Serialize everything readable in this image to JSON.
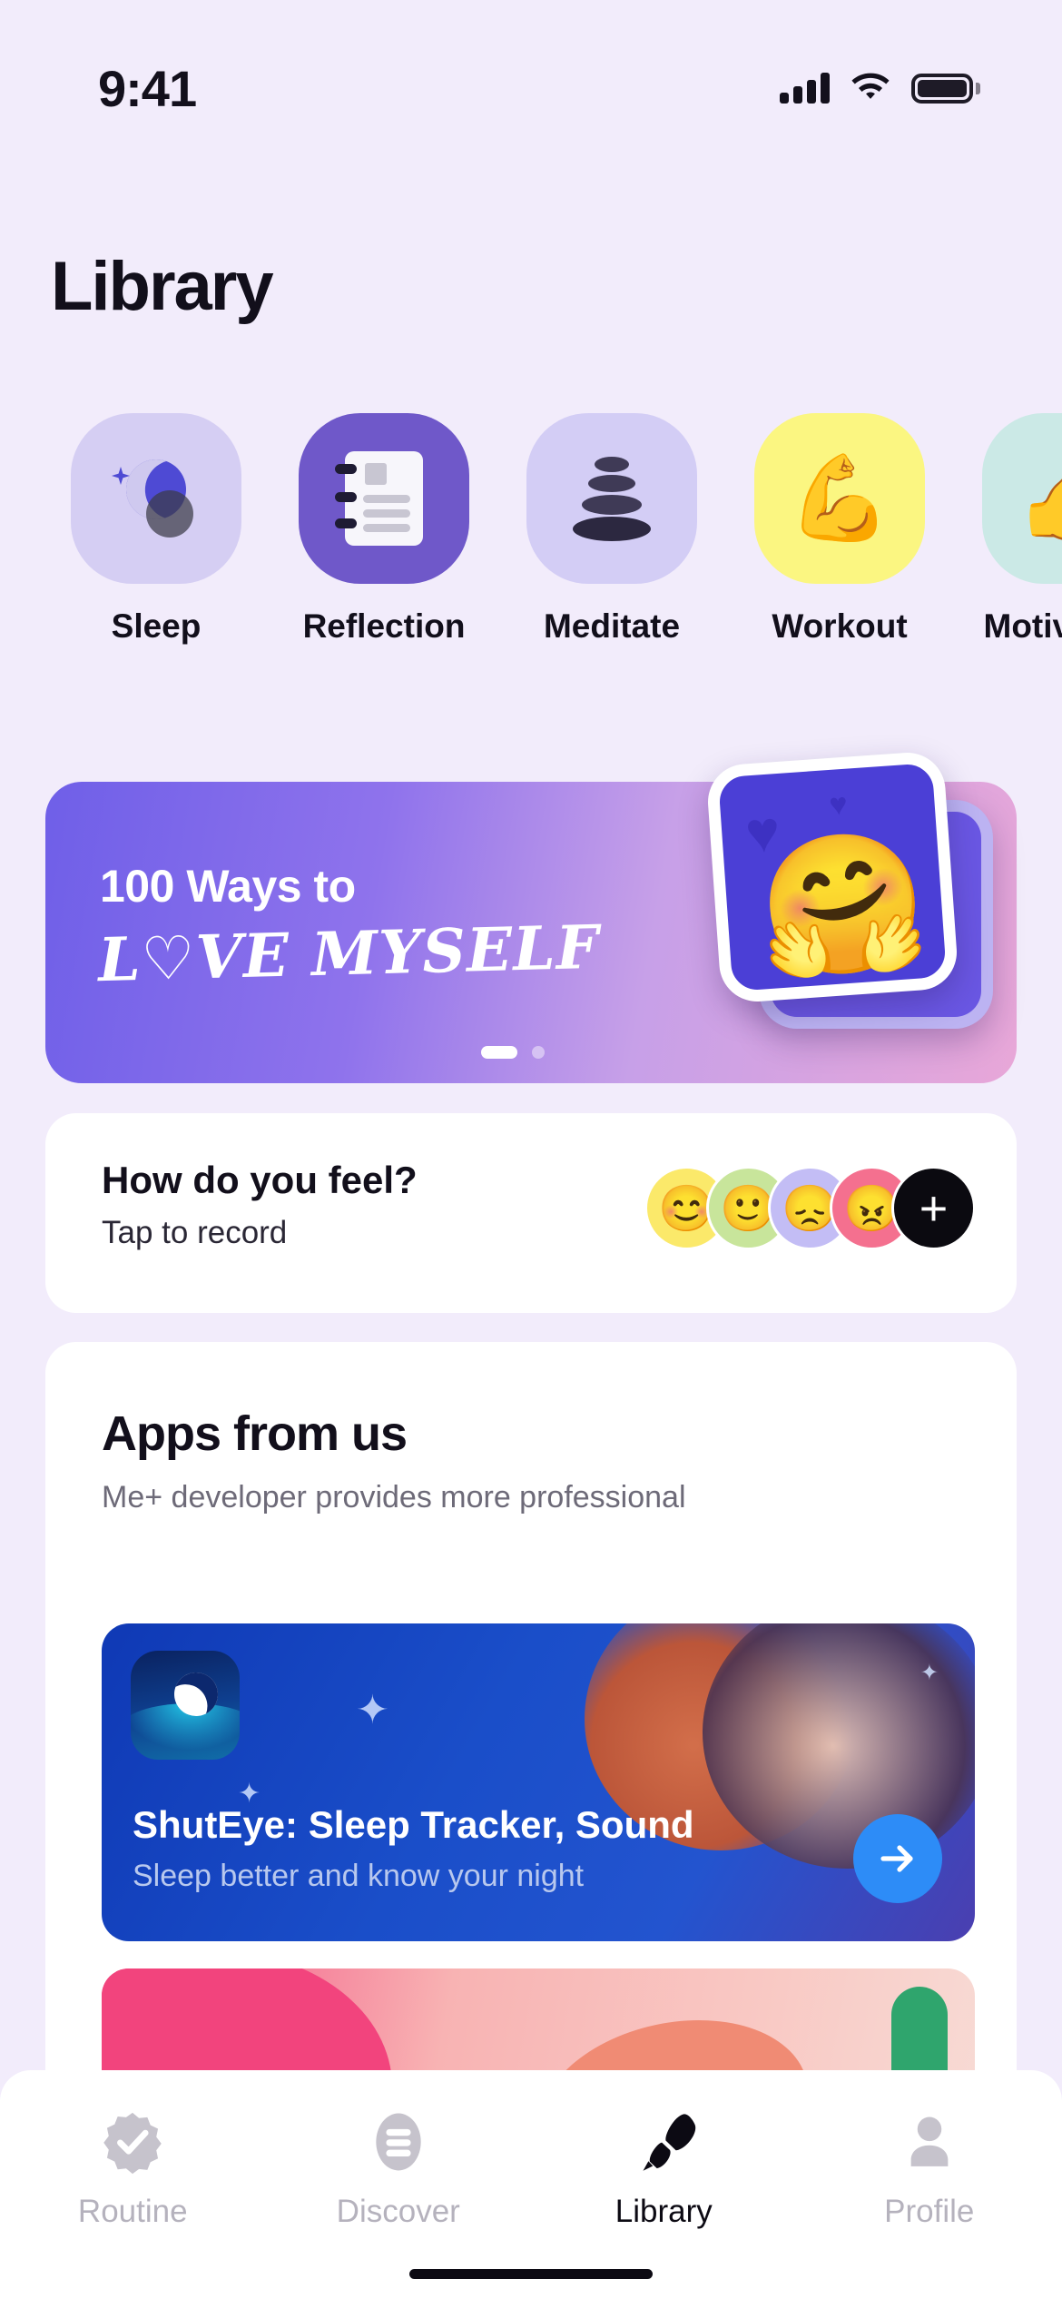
{
  "status_bar": {
    "time": "9:41",
    "signal_icon": "cellular-bars-icon",
    "wifi_icon": "wifi-icon",
    "battery_icon": "battery-full-icon"
  },
  "header": {
    "title": "Library"
  },
  "categories": [
    {
      "label": "Sleep",
      "icon": "moon-star-icon",
      "bg": "#d5cef3",
      "active": false
    },
    {
      "label": "Reflection",
      "icon": "notebook-icon",
      "bg": "#6f58c9",
      "active": true
    },
    {
      "label": "Meditate",
      "icon": "zen-stones-icon",
      "bg": "#d3cdf5",
      "active": false
    },
    {
      "label": "Workout",
      "icon": "flexed-biceps-icon",
      "bg": "#fbf681",
      "active": false
    },
    {
      "label": "Motivation",
      "icon": "thumbs-up-icon",
      "bg": "#cbe9e6",
      "active": false
    }
  ],
  "hero": {
    "line1": "100 Ways to",
    "line2": "L♡VE MYSELF",
    "emoji": "🤗",
    "heart_large": "♥",
    "heart_small": "♥",
    "pagination": {
      "total": 2,
      "active_index": 0
    }
  },
  "mood": {
    "title": "How do you feel?",
    "subtitle": "Tap to record",
    "faces": [
      {
        "name": "mood-happy",
        "emoji": "😊",
        "color": "#fbe96a"
      },
      {
        "name": "mood-good",
        "emoji": "🙂",
        "color": "#c8e59b"
      },
      {
        "name": "mood-sad",
        "emoji": "😞",
        "color": "#c3bdf5"
      },
      {
        "name": "mood-angry",
        "emoji": "😠",
        "color": "#f4708f"
      }
    ],
    "add_label": "+"
  },
  "apps": {
    "title": "Apps from us",
    "subtitle": "Me+ developer provides more professional",
    "items": [
      {
        "name": "ShutEye: Sleep Tracker, Sound",
        "description": "Sleep better and know your night",
        "icon": "crescent-moon-app-icon",
        "action_icon": "arrow-right-icon",
        "accent": "#2d8cf7"
      },
      {
        "name": "",
        "description": "",
        "icon": "yoga-app-icon",
        "action_icon": "arrow-right-icon",
        "accent": "#f2447d"
      }
    ]
  },
  "tabbar": {
    "items": [
      {
        "label": "Routine",
        "icon": "verified-check-icon",
        "active": false
      },
      {
        "label": "Discover",
        "icon": "list-pill-icon",
        "active": false
      },
      {
        "label": "Library",
        "icon": "marker-pen-icon",
        "active": true
      },
      {
        "label": "Profile",
        "icon": "person-icon",
        "active": false
      }
    ]
  },
  "theme": {
    "background": "#f2ecfb",
    "card": "#ffffff",
    "text": "#120f1b",
    "muted": "#6d6a78",
    "accent": "#6f58c9"
  }
}
